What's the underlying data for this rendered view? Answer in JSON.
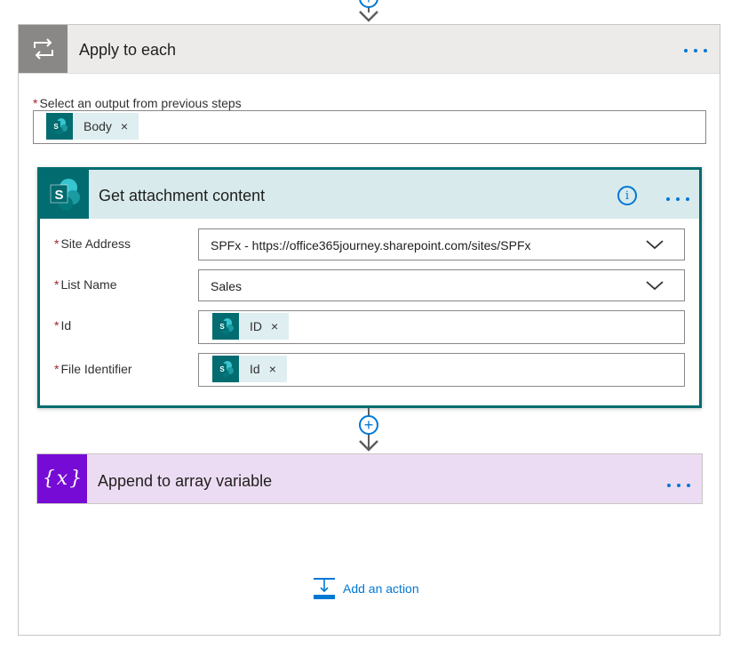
{
  "apply_to_each": {
    "title": "Apply to each",
    "more_label": "…",
    "output_field": {
      "required_mark": "*",
      "label": "Select an output from previous steps",
      "token": {
        "text": "Body",
        "remove": "×"
      }
    }
  },
  "get_attachment": {
    "title": "Get attachment content",
    "info_label": "i",
    "more_label": "…",
    "fields": {
      "site_address": {
        "required_mark": "*",
        "label": "Site Address",
        "value": "SPFx - https://office365journey.sharepoint.com/sites/SPFx"
      },
      "list_name": {
        "required_mark": "*",
        "label": "List Name",
        "value": "Sales"
      },
      "id": {
        "required_mark": "*",
        "label": "Id",
        "token": {
          "text": "ID",
          "remove": "×"
        }
      },
      "file_identifier": {
        "required_mark": "*",
        "label": "File Identifier",
        "token": {
          "text": "Id",
          "remove": "×"
        }
      }
    }
  },
  "append_variable": {
    "title": "Append to array variable",
    "more_label": "…"
  },
  "add_action": {
    "label": "Add an action"
  },
  "connector_plus": "+",
  "icons": {
    "loop": "loop-icon",
    "sharepoint": "sharepoint-icon",
    "variable": "variable-icon",
    "add_action": "add-action-icon"
  },
  "colors": {
    "accent": "#0078d4",
    "sharepoint": "#036c70",
    "variable": "#770bd6",
    "variable_header": "#ecdcf3",
    "sharepoint_header": "#d8eaec",
    "required": "#a4262c"
  }
}
